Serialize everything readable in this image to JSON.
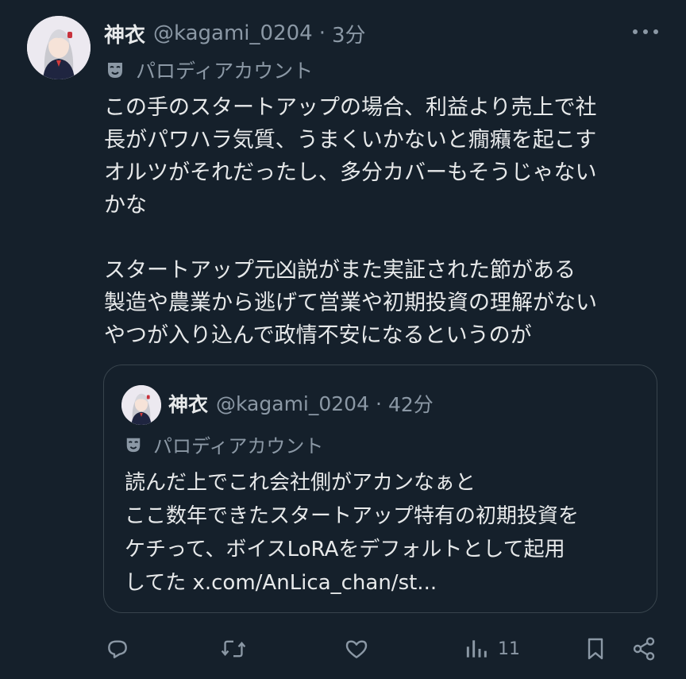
{
  "tweet": {
    "author_name": "神衣",
    "handle": "@kagami_0204",
    "separator": "·",
    "time": "3分",
    "label": "パロディアカウント",
    "avatar_icon": "anime-girl-avatar",
    "text_lines": [
      "この手のスタートアップの場合、利益より売上で社",
      "長がパワハラ気質、うまくいかないと癇癪を起こす",
      "オルツがそれだったし、多分カバーもそうじゃない",
      "かな",
      "",
      "スタートアップ元凶説がまた実証された節がある",
      "製造や農業から逃げて営業や初期投資の理解がない",
      "やつが入り込んで政情不安になるというのが"
    ]
  },
  "quote": {
    "author_name": "神衣",
    "handle": "@kagami_0204",
    "separator": "·",
    "time": "42分",
    "label": "パロディアカウント",
    "text_lines": [
      "読んだ上でこれ会社側がアカンなぁと",
      "ここ数年できたスタートアップ特有の初期投資を",
      "ケチって、ボイスLoRAをデフォルトとして起用",
      "してた x.com/AnLica_chan/st..."
    ]
  },
  "actions": {
    "reply_icon": "reply-icon",
    "retweet_icon": "retweet-icon",
    "like_icon": "heart-icon",
    "views_icon": "views-bar-icon",
    "views_count": "11",
    "bookmark_icon": "bookmark-icon",
    "share_icon": "share-icon"
  },
  "colors": {
    "background": "#15202b",
    "text": "#e7e9ea",
    "secondary": "#8b98a5",
    "border": "#38444d"
  }
}
